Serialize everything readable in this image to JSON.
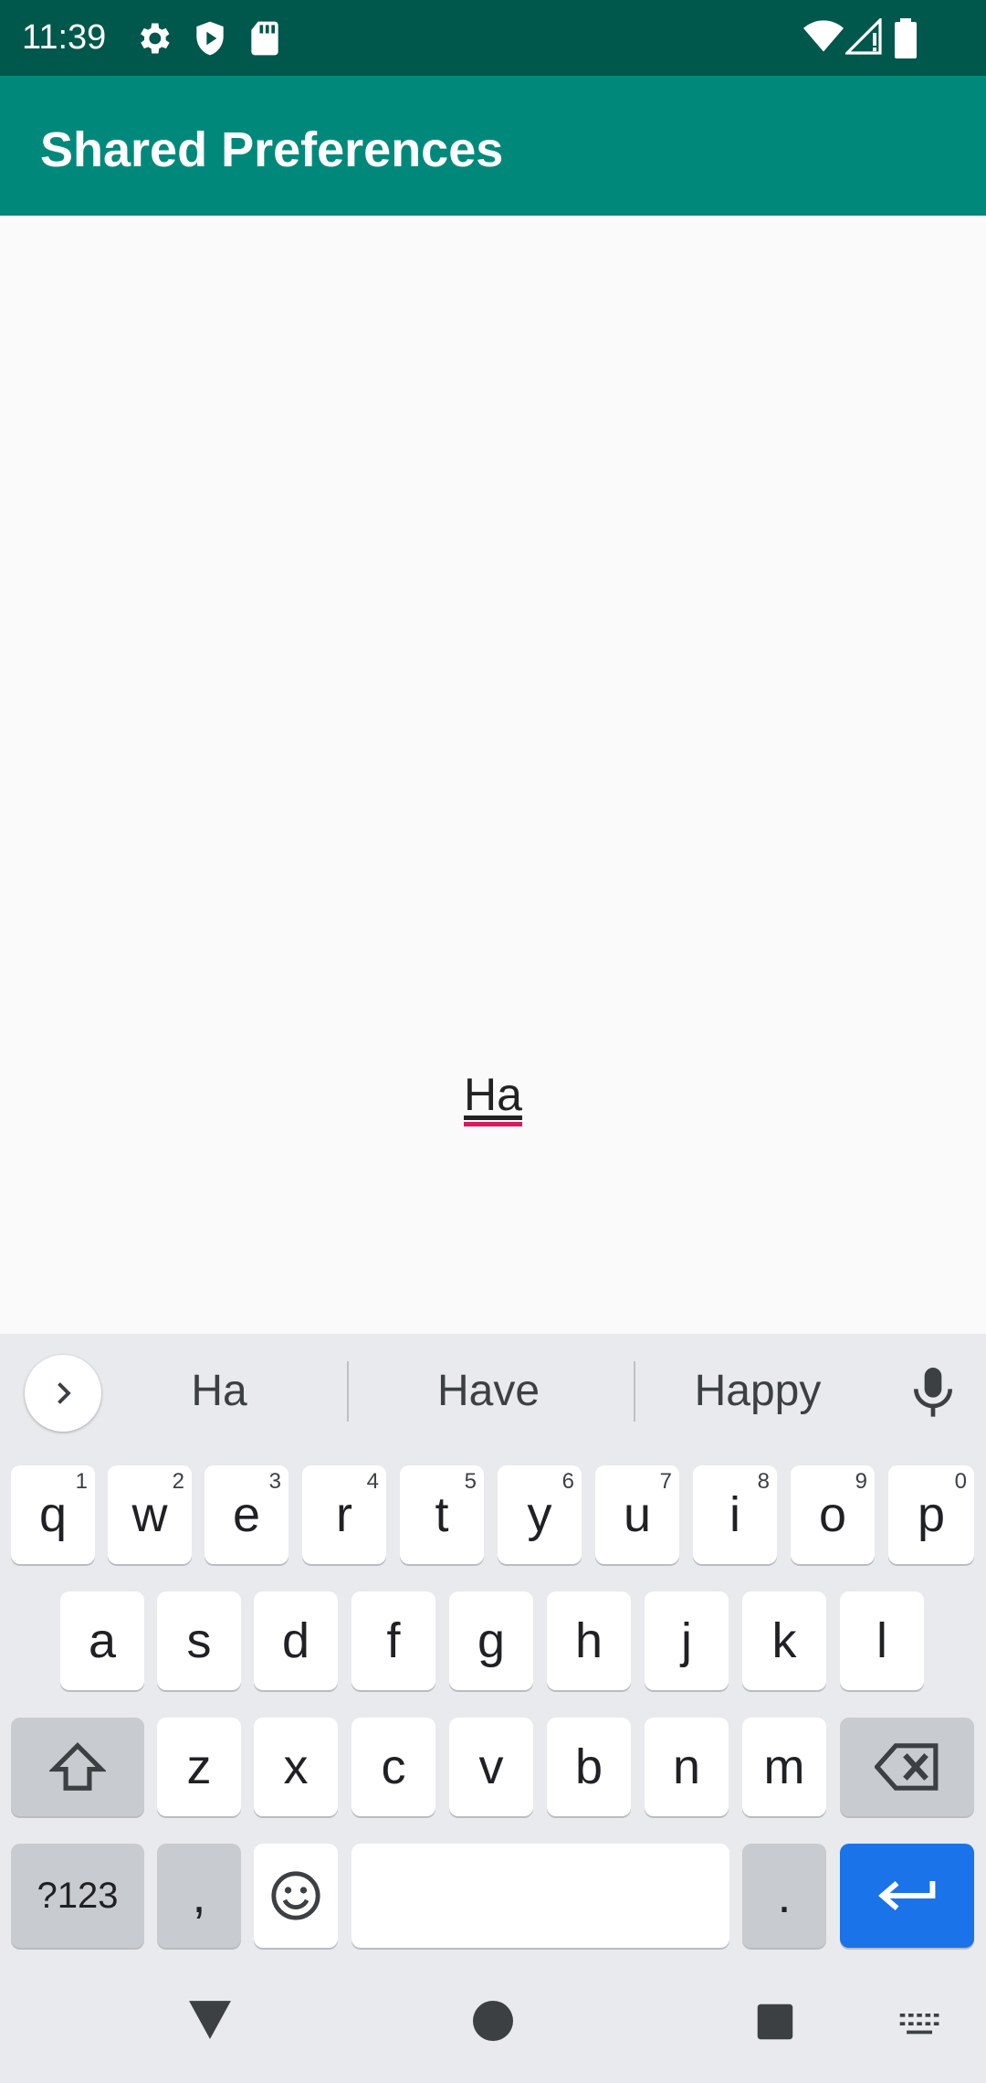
{
  "status_bar": {
    "time": "11:39",
    "icons": [
      "gear-icon",
      "shield-play-icon",
      "sd-card-icon",
      "wifi-icon",
      "signal-icon",
      "battery-icon"
    ]
  },
  "app_bar": {
    "title": "Shared Preferences"
  },
  "edit_text": {
    "value": "Ha"
  },
  "keyboard": {
    "suggestions": [
      "Ha",
      "Have",
      "Happy"
    ],
    "row1": [
      {
        "key": "q",
        "hint": "1"
      },
      {
        "key": "w",
        "hint": "2"
      },
      {
        "key": "e",
        "hint": "3"
      },
      {
        "key": "r",
        "hint": "4"
      },
      {
        "key": "t",
        "hint": "5"
      },
      {
        "key": "y",
        "hint": "6"
      },
      {
        "key": "u",
        "hint": "7"
      },
      {
        "key": "i",
        "hint": "8"
      },
      {
        "key": "o",
        "hint": "9"
      },
      {
        "key": "p",
        "hint": "0"
      }
    ],
    "row2": [
      "a",
      "s",
      "d",
      "f",
      "g",
      "h",
      "j",
      "k",
      "l"
    ],
    "row3": [
      "z",
      "x",
      "c",
      "v",
      "b",
      "n",
      "m"
    ],
    "symbols_label": "?123",
    "comma_label": ",",
    "period_label": ".",
    "colors": {
      "accent": "#1a73e8",
      "app_bar": "#00897b",
      "status_bar": "#00574b",
      "cursor": "#d81b60"
    }
  }
}
